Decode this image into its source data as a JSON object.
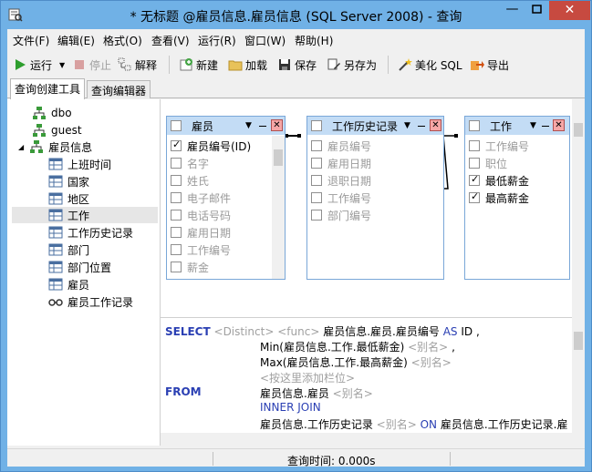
{
  "window": {
    "title": "* 无标题 @雇员信息.雇员信息 (SQL Server 2008) - 查询",
    "minimize": "—",
    "close": "✕"
  },
  "menu": [
    {
      "label": "文件(F)"
    },
    {
      "label": "编辑(E)"
    },
    {
      "label": "格式(O)"
    },
    {
      "label": "查看(V)"
    },
    {
      "label": "运行(R)"
    },
    {
      "label": "窗口(W)"
    },
    {
      "label": "帮助(H)"
    }
  ],
  "toolbar": {
    "run": "运行",
    "stop": "停止",
    "explain": "解释",
    "new": "新建",
    "load": "加载",
    "save": "保存",
    "save_as": "另存为",
    "beautify": "美化 SQL",
    "export": "导出"
  },
  "tabs": [
    {
      "label": "查询创建工具"
    },
    {
      "label": "查询编辑器"
    }
  ],
  "tree": [
    {
      "label": "dbo",
      "icon": "schema-icon"
    },
    {
      "label": "guest",
      "icon": "schema-icon"
    },
    {
      "label": "雇员信息",
      "icon": "schema-icon"
    },
    {
      "label": "上班时间",
      "icon": "table-icon"
    },
    {
      "label": "国家",
      "icon": "table-icon"
    },
    {
      "label": "地区",
      "icon": "table-icon"
    },
    {
      "label": "工作",
      "icon": "table-icon"
    },
    {
      "label": "工作历史记录",
      "icon": "table-icon"
    },
    {
      "label": "部门",
      "icon": "table-icon"
    },
    {
      "label": "部门位置",
      "icon": "table-icon"
    },
    {
      "label": "雇员",
      "icon": "table-icon"
    },
    {
      "label": "雇员工作记录",
      "icon": "view-icon"
    }
  ],
  "tables": [
    {
      "name": "雇员",
      "fields": [
        {
          "label": "雇员编号(ID)",
          "checked": true
        },
        {
          "label": "名字",
          "checked": false
        },
        {
          "label": "姓氏",
          "checked": false
        },
        {
          "label": "电子邮件",
          "checked": false
        },
        {
          "label": "电话号码",
          "checked": false
        },
        {
          "label": "雇用日期",
          "checked": false
        },
        {
          "label": "工作编号",
          "checked": false
        },
        {
          "label": "薪金",
          "checked": false
        }
      ]
    },
    {
      "name": "工作历史记录",
      "fields": [
        {
          "label": "雇员编号",
          "checked": false
        },
        {
          "label": "雇用日期",
          "checked": false
        },
        {
          "label": "退职日期",
          "checked": false
        },
        {
          "label": "工作编号",
          "checked": false
        },
        {
          "label": "部门编号",
          "checked": false
        }
      ]
    },
    {
      "name": "工作",
      "fields": [
        {
          "label": "工作编号",
          "checked": false
        },
        {
          "label": "职位",
          "checked": false
        },
        {
          "label": "最低薪金",
          "checked": true
        },
        {
          "label": "最高薪金",
          "checked": true
        }
      ]
    }
  ],
  "sql": {
    "select_kw": "SELECT",
    "distinct": "<Distinct>",
    "func": "<func>",
    "col1": "雇员信息.雇员.雇员编号",
    "as_kw": "AS",
    "col1_alias": "ID ,",
    "col2": "Min(雇员信息.工作.最低薪金)",
    "alias_ph": "<别名>",
    "comma": ",",
    "col3": "Max(雇员信息.工作.最高薪金)",
    "add_col": "<按这里添加栏位>",
    "from_kw": "FROM",
    "from_table": "雇员信息.雇员",
    "join_kw": "INNER JOIN",
    "join_table": "雇员信息.工作历史记录",
    "on_kw": "ON",
    "on_cond": "雇员信息.工作历史记录.雇"
  },
  "status": {
    "query_time": "查询时间: 0.000s"
  },
  "colors": {
    "title_bg": "#70b1e6",
    "keyword": "#2a3fb3",
    "table_header": "#c3dcf5"
  }
}
